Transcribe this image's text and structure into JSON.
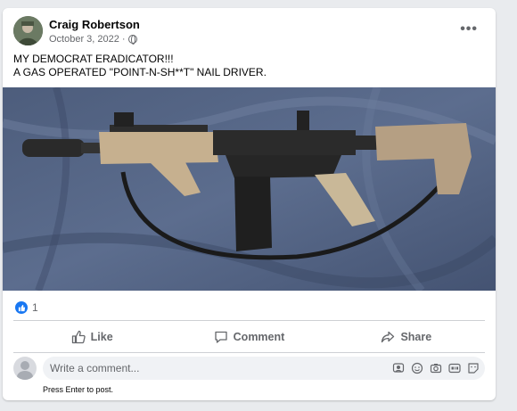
{
  "post": {
    "author": "Craig Robertson",
    "date": "October 3, 2022",
    "date_separator": "·",
    "more_label": "•••",
    "text_line1": "MY DEMOCRAT ERADICATOR!!!",
    "text_line2": "A GAS OPERATED \"POINT-N-SH**T\" NAIL DRIVER."
  },
  "reactions": {
    "count": "1",
    "icon": "like-icon",
    "color": "#1877f2"
  },
  "actions": [
    {
      "label": "Like",
      "icon": "thumbs-up-icon"
    },
    {
      "label": "Comment",
      "icon": "comment-bubble-icon"
    },
    {
      "label": "Share",
      "icon": "share-arrow-icon"
    }
  ],
  "comment_box": {
    "placeholder": "Write a comment...",
    "hint": "Press Enter to post.",
    "icons": [
      "avatar-sticker-icon",
      "emoji-icon",
      "camera-icon",
      "gif-icon",
      "sticker-icon"
    ]
  },
  "colors": {
    "accent": "#1877f2",
    "secondary_text": "#65676b",
    "background": "#e9ebee"
  }
}
